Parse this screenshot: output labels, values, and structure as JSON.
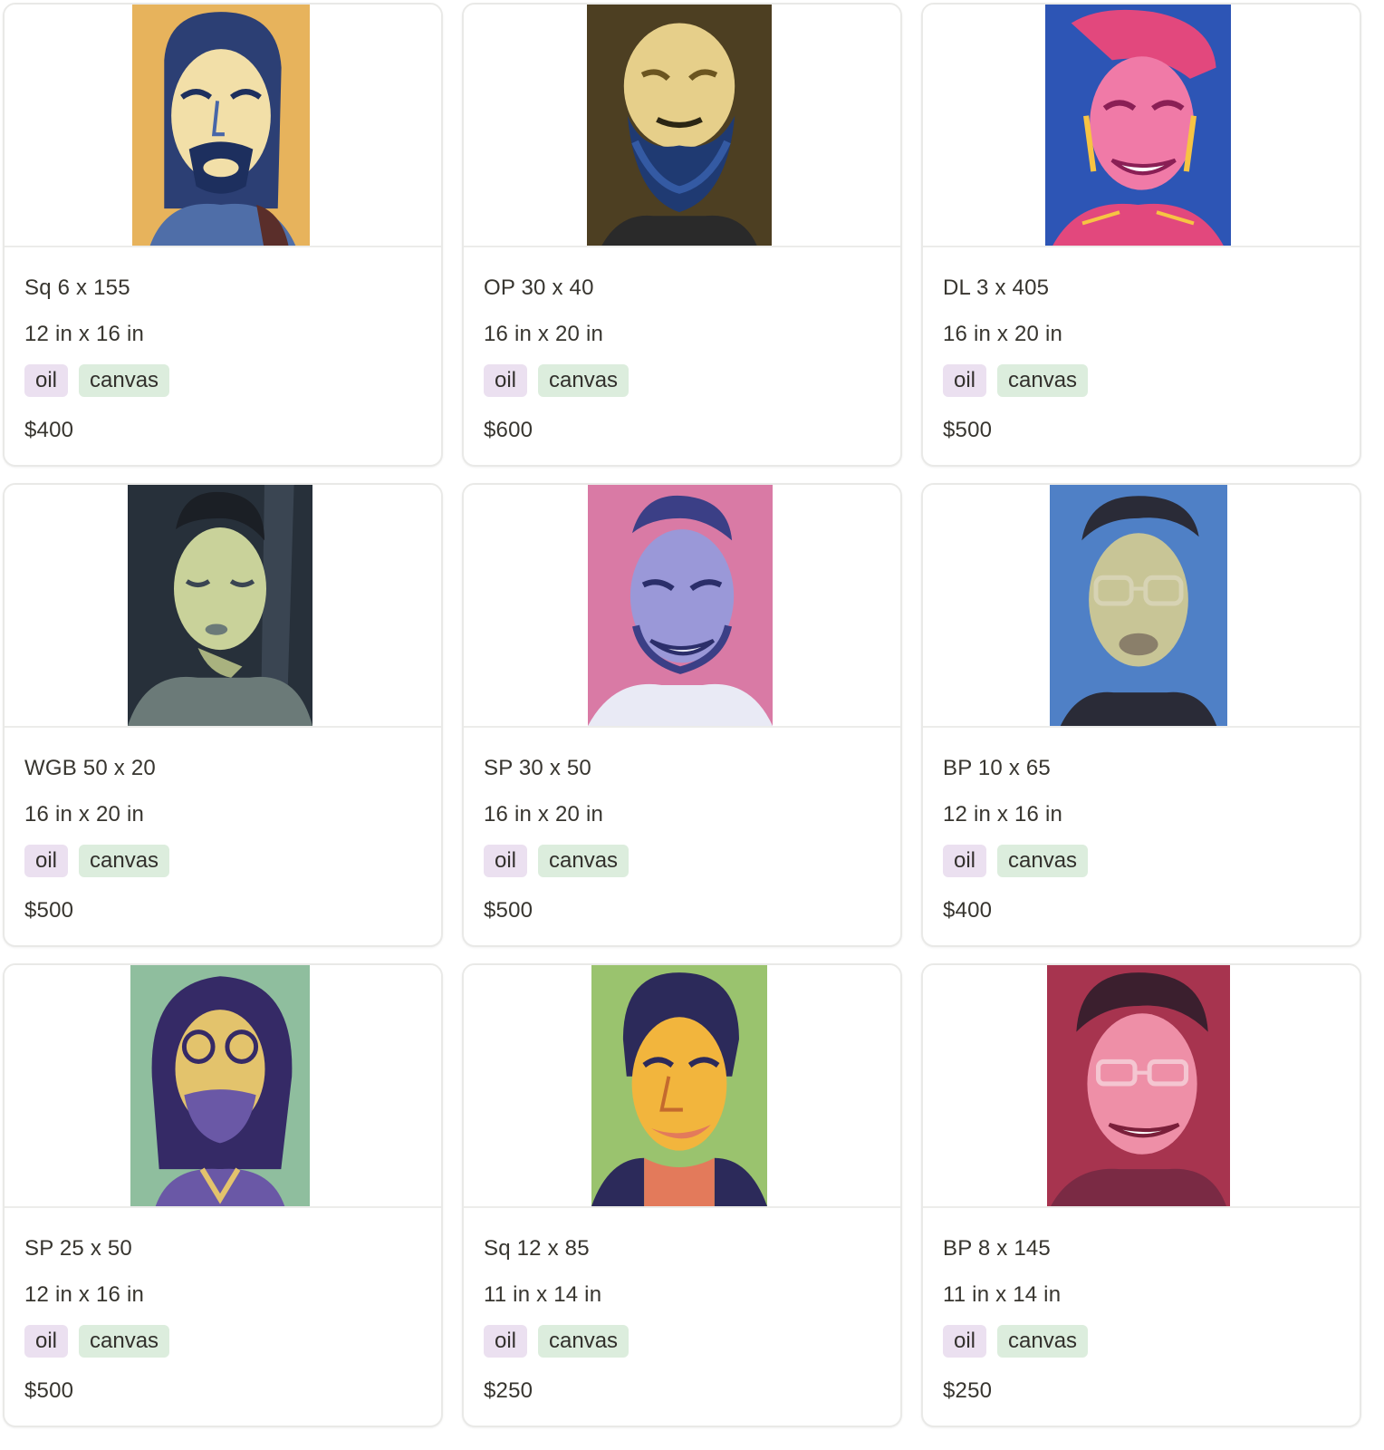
{
  "gallery": {
    "cards": [
      {
        "title": "Sq 6 x 155",
        "dimensions": "12 in x 16 in",
        "tags": [
          "oil",
          "canvas"
        ],
        "price": "$400",
        "image": {
          "subject": "portrait-grimace-goatee",
          "palette": [
            "#e7b35c",
            "#2f4d8f",
            "#f2dfa8",
            "#1d2f5e"
          ]
        }
      },
      {
        "title": "OP 30 x 40",
        "dimensions": "16 in x 20 in",
        "tags": [
          "oil",
          "canvas"
        ],
        "price": "$600",
        "image": {
          "subject": "portrait-bearded-squint",
          "palette": [
            "#4d3f22",
            "#e6cf8a",
            "#1f3a72",
            "#2a2a2a"
          ]
        }
      },
      {
        "title": "DL 3 x 405",
        "dimensions": "16 in x 20 in",
        "tags": [
          "oil",
          "canvas"
        ],
        "price": "$500",
        "image": {
          "subject": "portrait-pink-grin",
          "palette": [
            "#2d55b5",
            "#e2487d",
            "#f7c443",
            "#f07aa7"
          ]
        }
      },
      {
        "title": "WGB 50 x 20",
        "dimensions": "16 in x 20 in",
        "tags": [
          "oil",
          "canvas"
        ],
        "price": "$500",
        "image": {
          "subject": "portrait-eyes-closed",
          "palette": [
            "#27303a",
            "#c9d29a",
            "#6b7a78",
            "#3a4552"
          ]
        }
      },
      {
        "title": "SP 30 x 50",
        "dimensions": "16 in x 20 in",
        "tags": [
          "oil",
          "canvas"
        ],
        "price": "$500",
        "image": {
          "subject": "portrait-violet-grimace",
          "palette": [
            "#d97aa5",
            "#9a98d8",
            "#3b3f86",
            "#e9eaf5"
          ]
        }
      },
      {
        "title": "BP 10 x 65",
        "dimensions": "12 in x 16 in",
        "tags": [
          "oil",
          "canvas"
        ],
        "price": "$400",
        "image": {
          "subject": "portrait-glasses-pout",
          "palette": [
            "#4f80c6",
            "#c8c596",
            "#2a2b37",
            "#d7d3b4"
          ]
        }
      },
      {
        "title": "SP 25 x 50",
        "dimensions": "12 in x 16 in",
        "tags": [
          "oil",
          "canvas"
        ],
        "price": "$500",
        "image": {
          "subject": "portrait-purple-glasses",
          "palette": [
            "#8fbe9e",
            "#6a58a6",
            "#e3c36c",
            "#352a66"
          ]
        }
      },
      {
        "title": "Sq 12 x 85",
        "dimensions": "11 in x 14 in",
        "tags": [
          "oil",
          "canvas"
        ],
        "price": "$250",
        "image": {
          "subject": "portrait-yellow-smirk",
          "palette": [
            "#9ac36e",
            "#f2b53d",
            "#2c2a5a",
            "#e37a5b"
          ]
        }
      },
      {
        "title": "BP 8 x 145",
        "dimensions": "11 in x 14 in",
        "tags": [
          "oil",
          "canvas"
        ],
        "price": "$250",
        "image": {
          "subject": "portrait-red-grin",
          "palette": [
            "#a7344f",
            "#ee8fa7",
            "#3b1f2e",
            "#f4c6d1"
          ]
        }
      }
    ]
  }
}
